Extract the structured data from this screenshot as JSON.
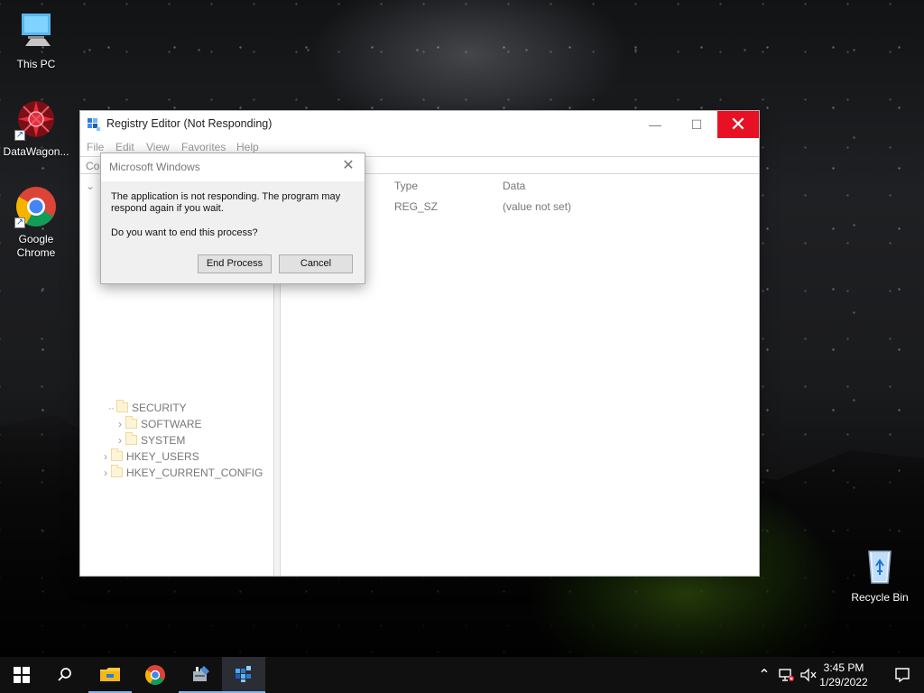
{
  "desktop": {
    "icons": [
      {
        "label": "This PC",
        "icon": "computer-icon"
      },
      {
        "label": "DataWagon...",
        "icon": "datawagon-icon"
      },
      {
        "label": "Google Chrome",
        "icon": "chrome-icon"
      },
      {
        "label": "Recycle Bin",
        "icon": "recycle-bin-icon"
      }
    ]
  },
  "registry_window": {
    "title": "Registry Editor (Not Responding)",
    "menu": [
      "File",
      "Edit",
      "View",
      "Favorites",
      "Help"
    ],
    "address_partial": "Co",
    "tree_items": [
      "SECURITY",
      "SOFTWARE",
      "SYSTEM",
      "HKEY_USERS",
      "HKEY_CURRENT_CONFIG"
    ],
    "list_headers": {
      "type": "Type",
      "data": "Data"
    },
    "list_row": {
      "type": "REG_SZ",
      "data": "(value not set)"
    },
    "controls": {
      "minimize": "—",
      "maximize": "☐",
      "close": "✕"
    }
  },
  "dialog": {
    "title": "Microsoft Windows",
    "close": "✕",
    "message": "The application is not responding. The program may respond again if you wait.",
    "question": "Do you want to end this process?",
    "buttons": {
      "end_process": "End Process",
      "cancel": "Cancel"
    }
  },
  "taskbar": {
    "items": [
      "start-icon",
      "search-icon",
      "file-explorer-icon",
      "chrome-icon",
      "server-manager-icon",
      "registry-editor-icon"
    ],
    "clock": {
      "time": "3:45 PM",
      "date": "1/29/2022"
    },
    "tray_icons": [
      "chevron-up-icon",
      "network-icon",
      "volume-muted-icon",
      "notification-icon"
    ]
  },
  "colors": {
    "close_red": "#e81123",
    "taskbar": "#101010",
    "accent": "#7eb4ea",
    "grass": "#85d625"
  }
}
